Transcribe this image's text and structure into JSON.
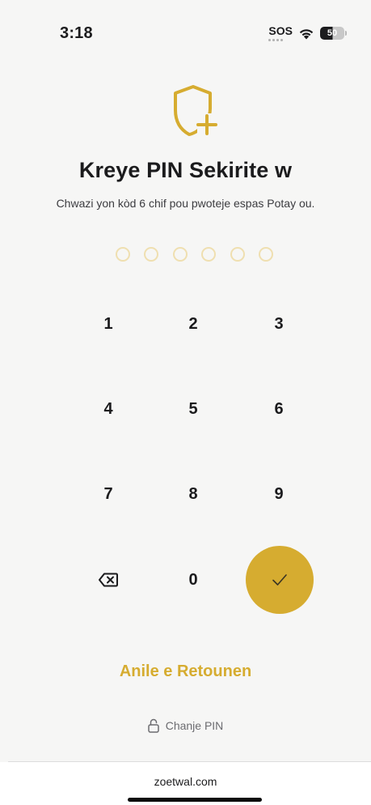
{
  "status_bar": {
    "time": "3:18",
    "sos": "SOS",
    "battery": "50",
    "icons": [
      "sos-indicator",
      "wifi-icon",
      "battery-icon"
    ]
  },
  "header": {
    "icon": "shield-plus-icon",
    "title": "Kreye PIN Sekirite w",
    "subtitle": "Chwazi yon kòd 6 chif pou pwoteje espas Potay ou."
  },
  "pin": {
    "length": 6,
    "entered": 0
  },
  "keypad": {
    "keys": [
      "1",
      "2",
      "3",
      "4",
      "5",
      "6",
      "7",
      "8",
      "9",
      "0"
    ],
    "backspace_icon": "backspace-icon",
    "confirm_icon": "checkmark-icon"
  },
  "actions": {
    "cancel_label": "Anile e Retounen",
    "change_pin_label": "Chanje PIN",
    "change_pin_icon": "lock-icon"
  },
  "browser": {
    "url": "zoetwal.com"
  },
  "colors": {
    "accent": "#d6ac30",
    "pin_dot": "#efdfb0",
    "background": "#f6f6f5",
    "text": "#1c1c1e"
  }
}
